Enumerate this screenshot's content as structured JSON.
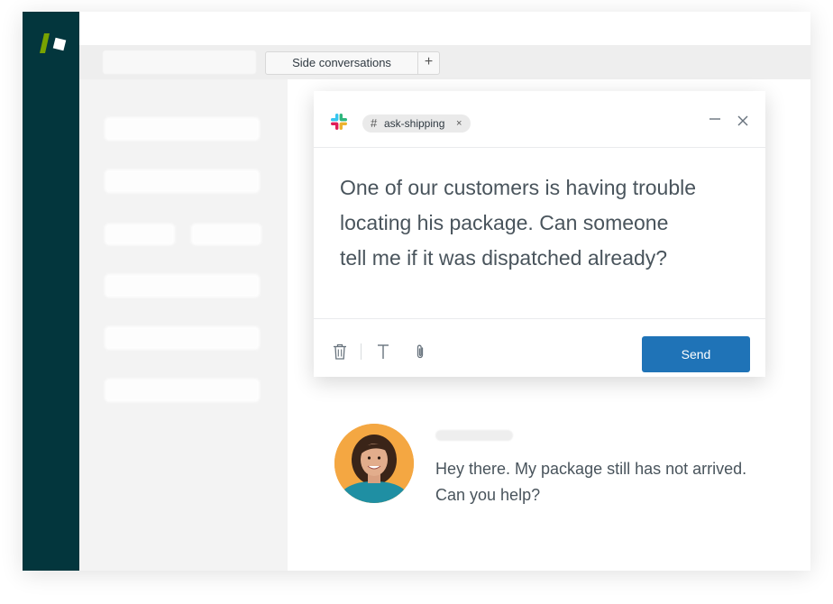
{
  "tabs": {
    "side_conversations_label": "Side conversations",
    "add_label": "+"
  },
  "composer": {
    "channel_hash": "#",
    "channel_name": "ask-shipping",
    "chip_remove": "×",
    "message_lines": [
      "One of our customers is having trouble",
      "locating his package. Can someone",
      "tell me if it was dispatched already?"
    ],
    "send_label": "Send"
  },
  "conversation": {
    "reply_lines": [
      "Hey there. My package still has not arrived.",
      "Can you help?"
    ]
  },
  "colors": {
    "sidebar": "#03363d",
    "logo_green": "#78a300",
    "send_blue": "#1f73b7",
    "avatar_bg": "#f4a742"
  },
  "icons": [
    "zendesk-logo-icon",
    "slack-logo-icon",
    "minimize-icon",
    "close-icon",
    "trash-icon",
    "text-format-icon",
    "paperclip-icon"
  ]
}
